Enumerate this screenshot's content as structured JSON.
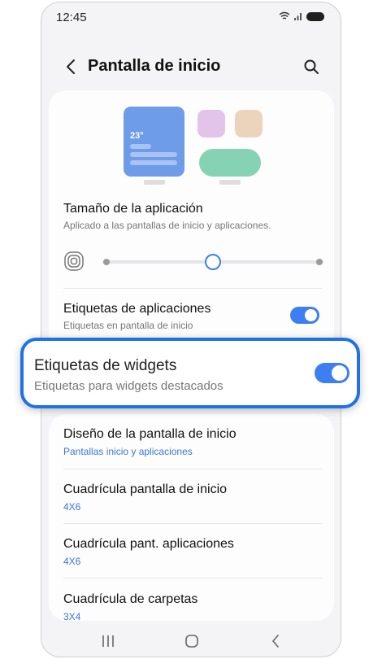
{
  "status_bar": {
    "time": "12:45"
  },
  "header": {
    "title": "Pantalla de inicio"
  },
  "preview": {
    "widget_temperature": "23°",
    "colors": {
      "widget": "#6f9ce9",
      "app1": "#e3c3ea",
      "app2": "#ecd3bc",
      "wide": "#86d2b4"
    }
  },
  "app_size": {
    "title": "Tamaño de la aplicación",
    "subtitle": "Aplicado a las pantallas de inicio y aplicaciones.",
    "slider_level": 0.5
  },
  "app_labels": {
    "title": "Etiquetas de aplicaciones",
    "subtitle": "Etiquetas en pantalla de inicio",
    "enabled": true
  },
  "widget_labels": {
    "title": "Etiquetas de widgets",
    "subtitle": "Etiquetas para widgets destacados",
    "enabled": true
  },
  "settings": [
    {
      "title": "Diseño de la pantalla de inicio",
      "value": "Pantallas inicio y aplicaciones"
    },
    {
      "title": "Cuadrícula pantalla de inicio",
      "value": "4X6"
    },
    {
      "title": "Cuadrícula pant. aplicaciones",
      "value": "4X6"
    },
    {
      "title": "Cuadrícula de carpetas",
      "value": "3X4"
    }
  ],
  "colors": {
    "accent": "#3d7ef0",
    "highlight_border": "#1d73e6",
    "link": "#3a77d8"
  },
  "nav": {
    "icons": [
      "recents-icon",
      "home-icon",
      "back-icon"
    ]
  }
}
